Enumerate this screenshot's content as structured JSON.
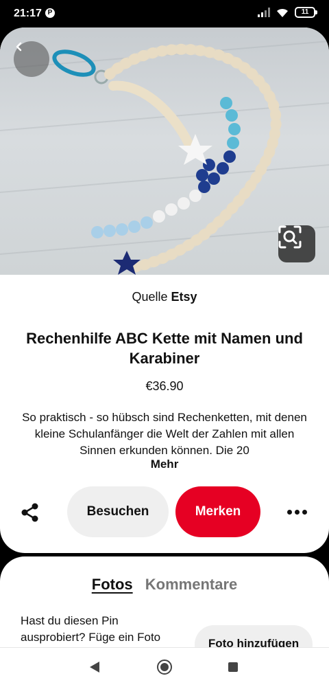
{
  "status_bar": {
    "time": "21:17",
    "notification_icon": "pinterest-icon",
    "battery_level": "11"
  },
  "pin": {
    "source_prefix": "Quelle",
    "source_name": "Etsy",
    "title": "Rechenhilfe ABC Kette mit Namen und Karabiner",
    "price": "€36.90",
    "description": "So praktisch - so hübsch sind Rechenketten, mit denen kleine Schulanfänger die Welt der Zahlen mit allen Sinnen erkunden können. Die 20",
    "more_label": "Mehr"
  },
  "actions": {
    "visit_label": "Besuchen",
    "save_label": "Merken",
    "save_color": "#e60023"
  },
  "photos": {
    "tab_photos": "Fotos",
    "tab_comments": "Kommentare",
    "prompt": "Hast du diesen Pin ausprobiert? Füge ein Foto",
    "add_photo_label": "Foto hinzufügen"
  }
}
